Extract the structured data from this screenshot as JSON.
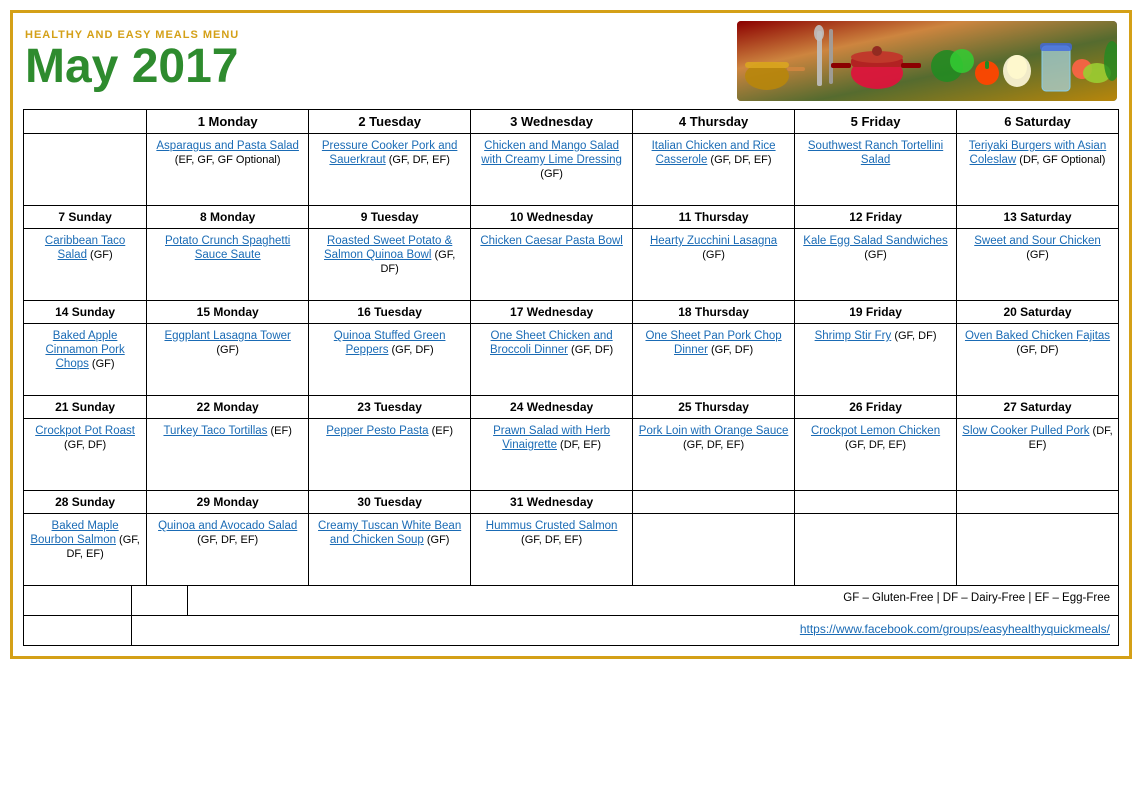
{
  "header": {
    "subtitle": "Healthy and Easy Meals Menu",
    "title": "May 2017",
    "image_alt": "Kitchen cookware and vegetables photo"
  },
  "days_of_week": [
    "",
    "1 Monday",
    "2 Tuesday",
    "3 Wednesday",
    "4 Thursday",
    "5 Friday",
    "6 Saturday"
  ],
  "weeks": [
    {
      "cells": [
        {
          "day": "",
          "meal": "",
          "tags": ""
        },
        {
          "day": "1 Monday",
          "meal": "Asparagus and Pasta Salad",
          "tags": "(EF, GF, GF Optional)"
        },
        {
          "day": "2 Tuesday",
          "meal": "Pressure Cooker Pork and Sauerkraut",
          "tags": "(GF, DF, EF)"
        },
        {
          "day": "3 Wednesday",
          "meal": "Chicken and Mango Salad with Creamy Lime Dressing",
          "tags": "(GF)"
        },
        {
          "day": "4 Thursday",
          "meal": "Italian Chicken and Rice Casserole",
          "tags": "(GF, DF, EF)"
        },
        {
          "day": "5 Friday",
          "meal": "Southwest Ranch Tortellini Salad",
          "tags": ""
        },
        {
          "day": "6 Saturday",
          "meal": "Teriyaki Burgers with Asian Coleslaw",
          "tags": "(DF, GF Optional)"
        }
      ]
    },
    {
      "cells": [
        {
          "day": "7 Sunday",
          "meal": "Caribbean Taco Salad",
          "tags": "(GF)"
        },
        {
          "day": "8 Monday",
          "meal": "Potato Crunch Spaghetti Sauce Saute",
          "tags": ""
        },
        {
          "day": "9 Tuesday",
          "meal": "Roasted Sweet Potato & Salmon Quinoa Bowl",
          "tags": "(GF, DF)"
        },
        {
          "day": "10 Wednesday",
          "meal": "Chicken Caesar Pasta Bowl",
          "tags": ""
        },
        {
          "day": "11 Thursday",
          "meal": "Hearty Zucchini Lasagna",
          "tags": "(GF)"
        },
        {
          "day": "12 Friday",
          "meal": "Kale Egg Salad Sandwiches",
          "tags": "(GF)"
        },
        {
          "day": "13 Saturday",
          "meal": "Sweet and Sour Chicken",
          "tags": "(GF)"
        }
      ]
    },
    {
      "cells": [
        {
          "day": "14 Sunday",
          "meal": "Baked Apple Cinnamon Pork Chops",
          "tags": "(GF)"
        },
        {
          "day": "15 Monday",
          "meal": "Eggplant Lasagna Tower",
          "tags": "(GF)"
        },
        {
          "day": "16 Tuesday",
          "meal": "Quinoa Stuffed Green Peppers",
          "tags": "(GF, DF)"
        },
        {
          "day": "17 Wednesday",
          "meal": "One Sheet Chicken and Broccoli Dinner",
          "tags": "(GF, DF)"
        },
        {
          "day": "18 Thursday",
          "meal": "One Sheet Pan Pork Chop Dinner",
          "tags": "(GF, DF)"
        },
        {
          "day": "19 Friday",
          "meal": "Shrimp Stir Fry",
          "tags": "(GF, DF)"
        },
        {
          "day": "20 Saturday",
          "meal": "Oven Baked Chicken Fajitas",
          "tags": "(GF, DF)"
        }
      ]
    },
    {
      "cells": [
        {
          "day": "21 Sunday",
          "meal": "Crockpot Pot Roast",
          "tags": "(GF, DF)"
        },
        {
          "day": "22 Monday",
          "meal": "Turkey Taco Tortillas",
          "tags": "(EF)"
        },
        {
          "day": "23 Tuesday",
          "meal": "Pepper Pesto Pasta",
          "tags": "(EF)"
        },
        {
          "day": "24 Wednesday",
          "meal": "Prawn Salad with Herb Vinaigrette",
          "tags": "(DF, EF)"
        },
        {
          "day": "25 Thursday",
          "meal": "Pork Loin with Orange Sauce",
          "tags": "(GF, DF, EF)"
        },
        {
          "day": "26 Friday",
          "meal": "Crockpot Lemon Chicken",
          "tags": "(GF, DF, EF)"
        },
        {
          "day": "27 Saturday",
          "meal": "Slow Cooker Pulled Pork",
          "tags": "(DF, EF)"
        }
      ]
    },
    {
      "cells": [
        {
          "day": "28 Sunday",
          "meal": "Baked Maple Bourbon Salmon",
          "tags": "(GF, DF, EF)"
        },
        {
          "day": "29 Monday",
          "meal": "Quinoa and Avocado Salad",
          "tags": "(GF, DF, EF)"
        },
        {
          "day": "30 Tuesday",
          "meal": "Creamy Tuscan White Bean and Chicken Soup",
          "tags": "(GF)"
        },
        {
          "day": "31 Wednesday",
          "meal": "Hummus Crusted Salmon",
          "tags": "(GF, DF, EF)"
        },
        {
          "day": "",
          "meal": "",
          "tags": ""
        },
        {
          "day": "",
          "meal": "",
          "tags": ""
        },
        {
          "day": "",
          "meal": "",
          "tags": ""
        }
      ]
    }
  ],
  "footer": {
    "legend": "GF – Gluten-Free  |  DF – Dairy-Free  |  EF – Egg-Free",
    "url": "https://www.facebook.com/groups/easyhealthyquickmeals/"
  }
}
